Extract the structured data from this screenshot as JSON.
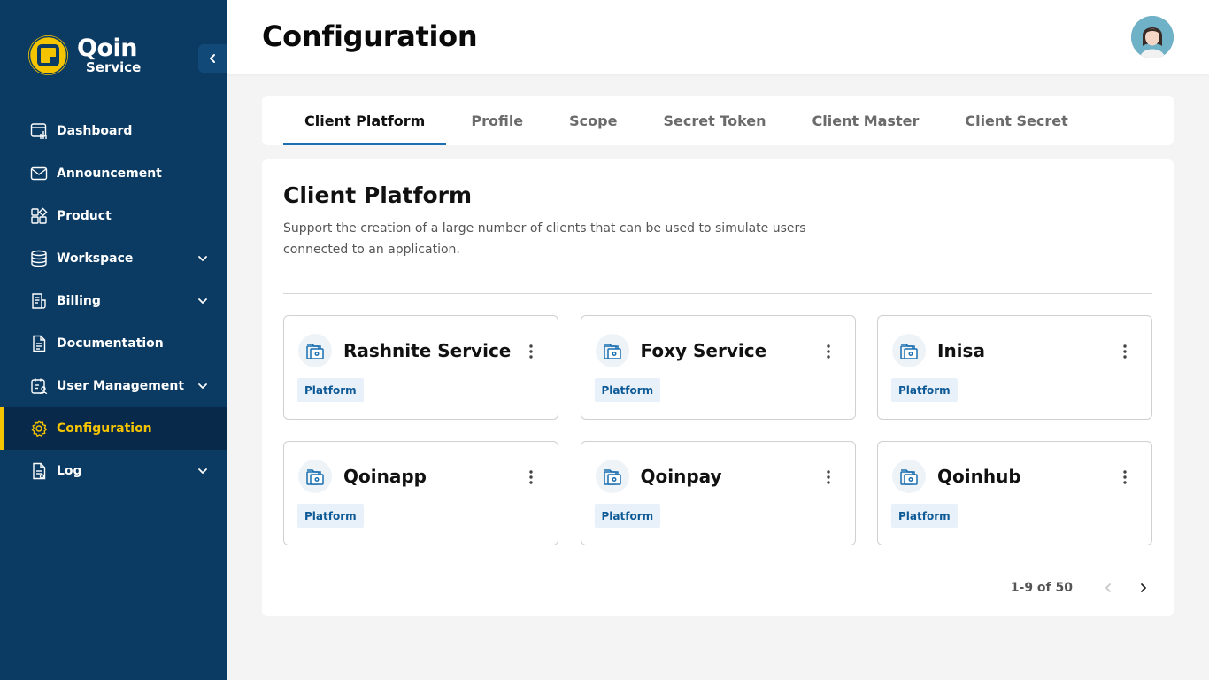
{
  "app": {
    "logo_title": "Qoin",
    "logo_subtitle": "Service"
  },
  "colors": {
    "sidebar_bg": "#0b3b63",
    "accent_yellow": "#f5c400",
    "tab_underline": "#1a6fb0",
    "badge_bg": "#e8f1f9",
    "badge_text": "#0e5a96"
  },
  "sidebar": {
    "items": [
      {
        "label": "Dashboard",
        "icon": "dashboard-icon",
        "has_chevron": false,
        "active": false
      },
      {
        "label": "Announcement",
        "icon": "mail-icon",
        "has_chevron": false,
        "active": false
      },
      {
        "label": "Product",
        "icon": "product-icon",
        "has_chevron": false,
        "active": false
      },
      {
        "label": "Workspace",
        "icon": "database-icon",
        "has_chevron": true,
        "active": false
      },
      {
        "label": "Billing",
        "icon": "billing-icon",
        "has_chevron": true,
        "active": false
      },
      {
        "label": "Documentation",
        "icon": "document-icon",
        "has_chevron": false,
        "active": false
      },
      {
        "label": "User Management",
        "icon": "user-management-icon",
        "has_chevron": true,
        "active": false
      },
      {
        "label": "Configuration",
        "icon": "gear-icon",
        "has_chevron": false,
        "active": true
      },
      {
        "label": "Log",
        "icon": "log-icon",
        "has_chevron": true,
        "active": false
      }
    ]
  },
  "header": {
    "title": "Configuration"
  },
  "tabs": [
    {
      "label": "Client Platform",
      "active": true
    },
    {
      "label": "Profile",
      "active": false
    },
    {
      "label": "Scope",
      "active": false
    },
    {
      "label": "Secret Token",
      "active": false
    },
    {
      "label": "Client Master",
      "active": false
    },
    {
      "label": "Client Secret",
      "active": false
    }
  ],
  "panel": {
    "title": "Client Platform",
    "description": "Support the creation of a large number of clients that can be used to simulate users connected to an application."
  },
  "cards": [
    {
      "name": "Rashnite Service",
      "badge": "Platform"
    },
    {
      "name": "Foxy Service",
      "badge": "Platform"
    },
    {
      "name": "Inisa",
      "badge": "Platform"
    },
    {
      "name": "Qoinapp",
      "badge": "Platform"
    },
    {
      "name": "Qoinpay",
      "badge": "Platform"
    },
    {
      "name": "Qoinhub",
      "badge": "Platform"
    }
  ],
  "pagination": {
    "text": "1-9 of 50"
  }
}
